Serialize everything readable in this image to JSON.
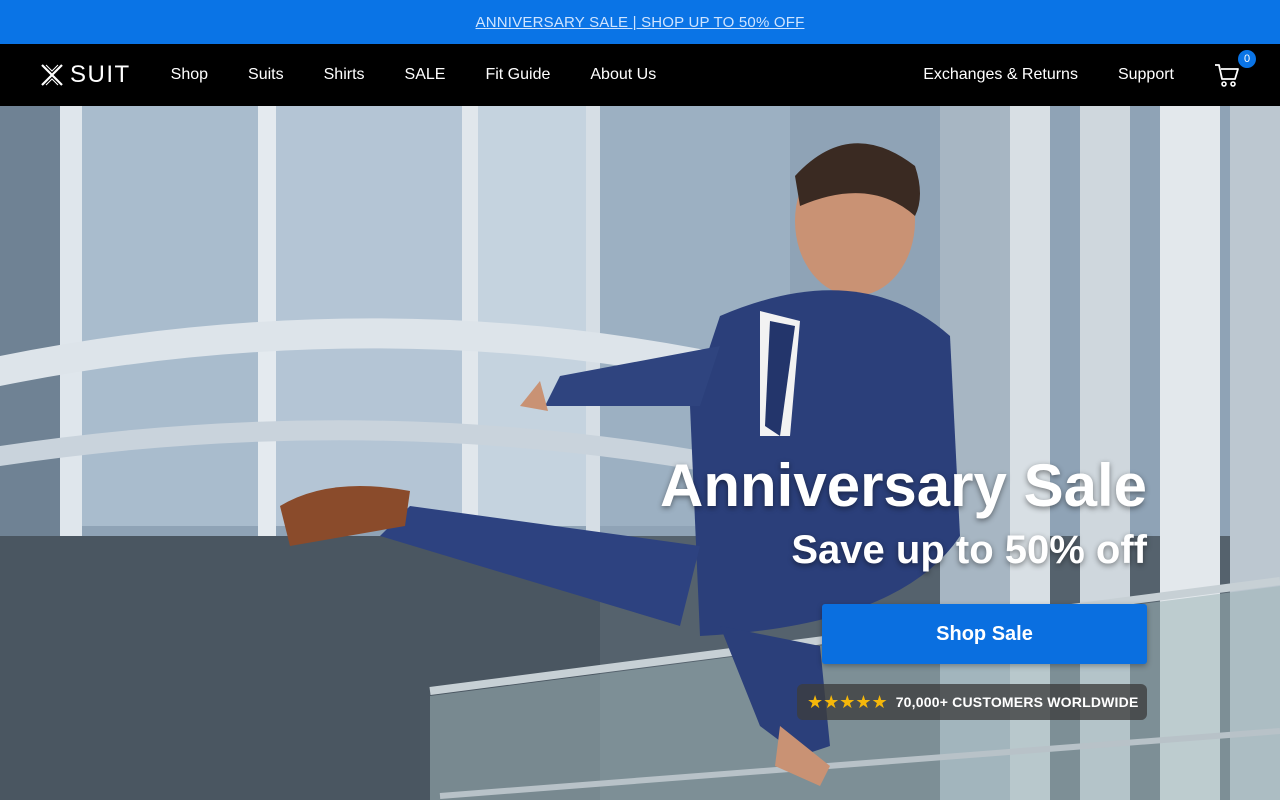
{
  "promo": {
    "text": "ANNIVERSARY SALE | SHOP UP TO 50% OFF"
  },
  "brand": {
    "name": "SUIT",
    "accent": "#0a74e6"
  },
  "nav": {
    "links": [
      "Shop",
      "Suits",
      "Shirts",
      "SALE",
      "Fit Guide",
      "About Us"
    ],
    "right_links": [
      "Exchanges & Returns",
      "Support"
    ],
    "cart_count": "0",
    "cart_icon": "cart-icon"
  },
  "hero": {
    "title": "Anniversary Sale",
    "subtitle": "Save up to 50% off",
    "cta": "Shop Sale",
    "stars": "★★★★★",
    "rating_text": "70,000+ CUSTOMERS WORLDWIDE"
  }
}
